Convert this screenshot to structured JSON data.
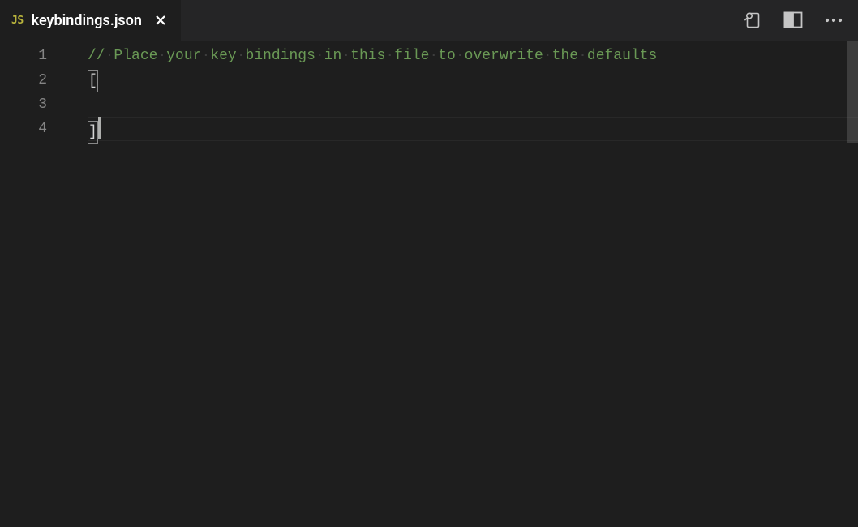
{
  "tab": {
    "icon_text": "JS",
    "filename": "keybindings.json"
  },
  "editor": {
    "line_numbers": [
      "1",
      "2",
      "3",
      "4"
    ],
    "lines": {
      "l1_comment_plain": "// Place your key bindings in this file to overwrite the defaults",
      "l2_bracket": "[",
      "l3_blank": "",
      "l4_bracket": "]"
    }
  }
}
